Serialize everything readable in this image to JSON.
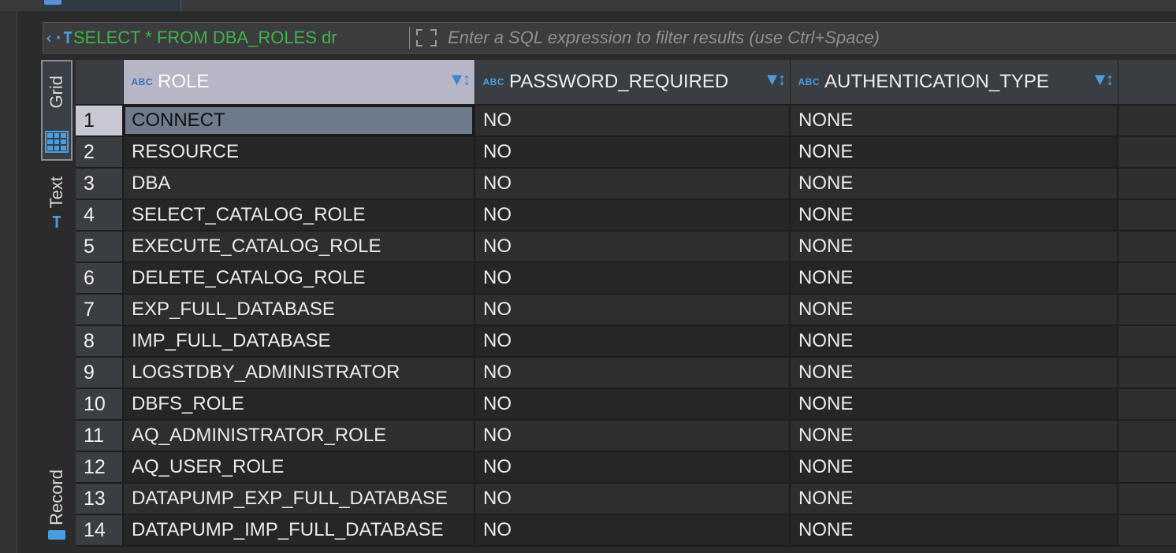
{
  "filter": {
    "query_label": "SELECT * FROM DBA_ROLES dr",
    "placeholder": "Enter a SQL expression to filter results (use Ctrl+Space)"
  },
  "side_tabs": {
    "grid": "Grid",
    "text": "Text",
    "record": "Record"
  },
  "table": {
    "type_badge": "ABC",
    "columns": [
      "ROLE",
      "PASSWORD_REQUIRED",
      "AUTHENTICATION_TYPE"
    ],
    "rows": [
      {
        "n": "1",
        "role": "CONNECT",
        "password_required": "NO",
        "authentication_type": "NONE"
      },
      {
        "n": "2",
        "role": "RESOURCE",
        "password_required": "NO",
        "authentication_type": "NONE"
      },
      {
        "n": "3",
        "role": "DBA",
        "password_required": "NO",
        "authentication_type": "NONE"
      },
      {
        "n": "4",
        "role": "SELECT_CATALOG_ROLE",
        "password_required": "NO",
        "authentication_type": "NONE"
      },
      {
        "n": "5",
        "role": "EXECUTE_CATALOG_ROLE",
        "password_required": "NO",
        "authentication_type": "NONE"
      },
      {
        "n": "6",
        "role": "DELETE_CATALOG_ROLE",
        "password_required": "NO",
        "authentication_type": "NONE"
      },
      {
        "n": "7",
        "role": "EXP_FULL_DATABASE",
        "password_required": "NO",
        "authentication_type": "NONE"
      },
      {
        "n": "8",
        "role": "IMP_FULL_DATABASE",
        "password_required": "NO",
        "authentication_type": "NONE"
      },
      {
        "n": "9",
        "role": "LOGSTDBY_ADMINISTRATOR",
        "password_required": "NO",
        "authentication_type": "NONE"
      },
      {
        "n": "10",
        "role": "DBFS_ROLE",
        "password_required": "NO",
        "authentication_type": "NONE"
      },
      {
        "n": "11",
        "role": "AQ_ADMINISTRATOR_ROLE",
        "password_required": "NO",
        "authentication_type": "NONE"
      },
      {
        "n": "12",
        "role": "AQ_USER_ROLE",
        "password_required": "NO",
        "authentication_type": "NONE"
      },
      {
        "n": "13",
        "role": "DATAPUMP_EXP_FULL_DATABASE",
        "password_required": "NO",
        "authentication_type": "NONE"
      },
      {
        "n": "14",
        "role": "DATAPUMP_IMP_FULL_DATABASE",
        "password_required": "NO",
        "authentication_type": "NONE"
      }
    ]
  },
  "colors": {
    "accent": "#4a9ee0",
    "query_green": "#3cb54a",
    "selected_cell": "#6e7b8c"
  }
}
